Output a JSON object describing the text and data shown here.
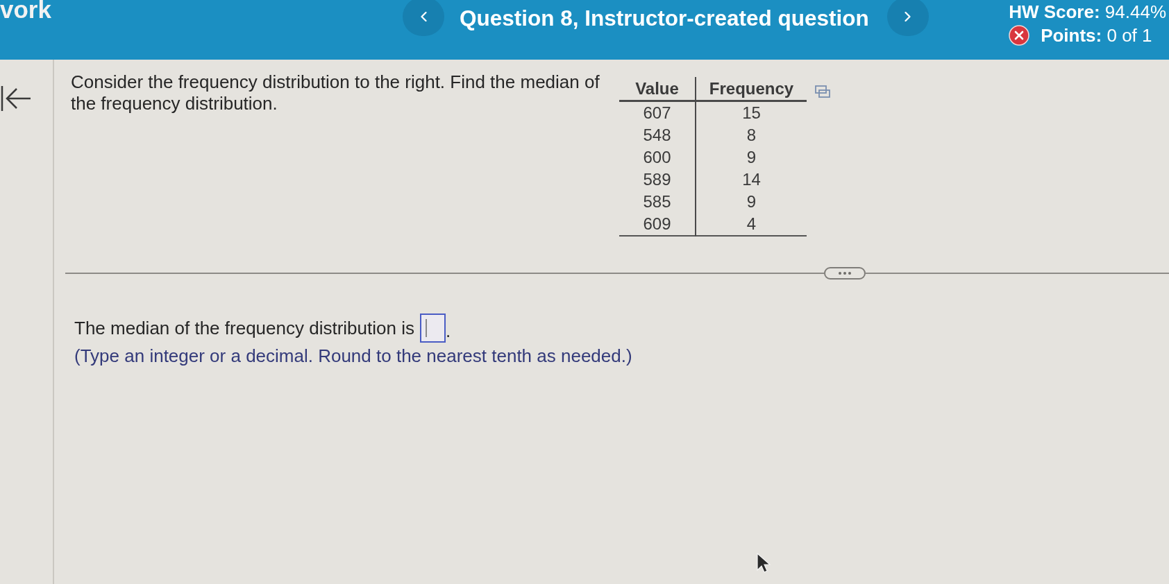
{
  "header": {
    "course_label": "vork",
    "title": "Question 8, Instructor-created question",
    "hw_score": "**HW Score:** 94.44%",
    "points": "**Points:** 0 of 1",
    "points_incorrect": true
  },
  "question": {
    "prompt": "Consider the frequency distribution to the right. Find the median of the frequency distribution.",
    "table": {
      "columns": [
        "Value",
        "Frequency"
      ],
      "rows": [
        [
          "607",
          "15"
        ],
        [
          "548",
          "8"
        ],
        [
          "600",
          "9"
        ],
        [
          "589",
          "14"
        ],
        [
          "585",
          "9"
        ],
        [
          "609",
          "4"
        ]
      ]
    }
  },
  "answer": {
    "sentence": "The median of the frequency distribution is",
    "sentence_end": ".",
    "focused": true,
    "hint": "(Type an integer or a decimal. Round to the nearest tenth as needed.)"
  }
}
